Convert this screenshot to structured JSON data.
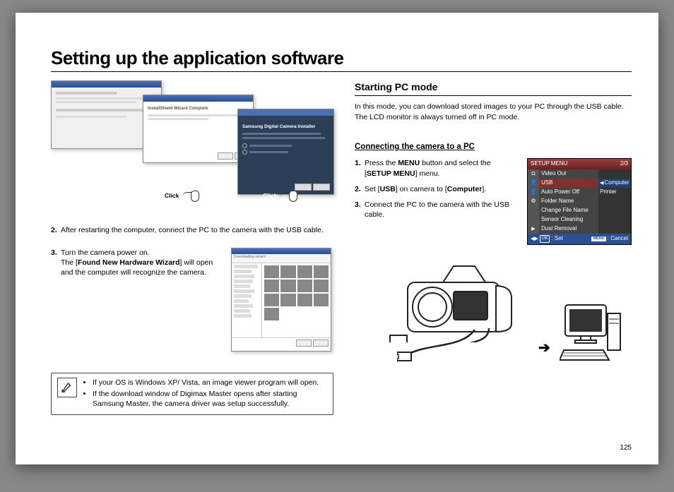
{
  "title": "Setting up the application software",
  "page_number": "125",
  "left": {
    "click_label": "Click",
    "step2_num": "2.",
    "step2": "After restarting the computer, connect the PC to the camera with the USB cable.",
    "step3_num": "3.",
    "step3a": "Turn the camera power on.",
    "step3b_pre": "The [",
    "step3b_bold": "Found New Hardware Wizard",
    "step3b_post": "] will open and the computer will recognize the camera.",
    "note1": "If your OS is Windows XP/ Vista, an image viewer program will open.",
    "note2": "If the download window of Digimax Master opens after starting Samsung Master, the camera driver was setup successfully."
  },
  "right": {
    "h2": "Starting PC mode",
    "intro": "In this mode, you can download stored images to your PC through the USB cable. The LCD monitor is always turned off in PC mode.",
    "h3": "Connecting the camera to a PC",
    "s1_num": "1.",
    "s1_a": "Press the ",
    "s1_b": "MENU",
    "s1_c": " button and select the [",
    "s1_d": "SETUP MENU",
    "s1_e": "] menu.",
    "s2_num": "2.",
    "s2_a": "Set [",
    "s2_b": "USB",
    "s2_c": "] on camera to [",
    "s2_d": "Computer",
    "s2_e": "].",
    "s3_num": "3.",
    "s3": "Connect the PC to the camera with the USB cable."
  },
  "setup_menu": {
    "title": "SETUP MENU",
    "page": "2/3",
    "items": [
      {
        "label": "Video Out"
      },
      {
        "label": "USB",
        "value": "Computer",
        "selected": true
      },
      {
        "label": "Auto Power Off",
        "value": "Printer"
      },
      {
        "label": "Folder Name"
      },
      {
        "label": "Change File Name"
      },
      {
        "label": "Sensor Cleaning"
      },
      {
        "label": "Dust Removal"
      }
    ],
    "ok_label": "OK",
    "set_label": ": Set",
    "menu_label": "MENU",
    "cancel_label": ": Cancel"
  }
}
